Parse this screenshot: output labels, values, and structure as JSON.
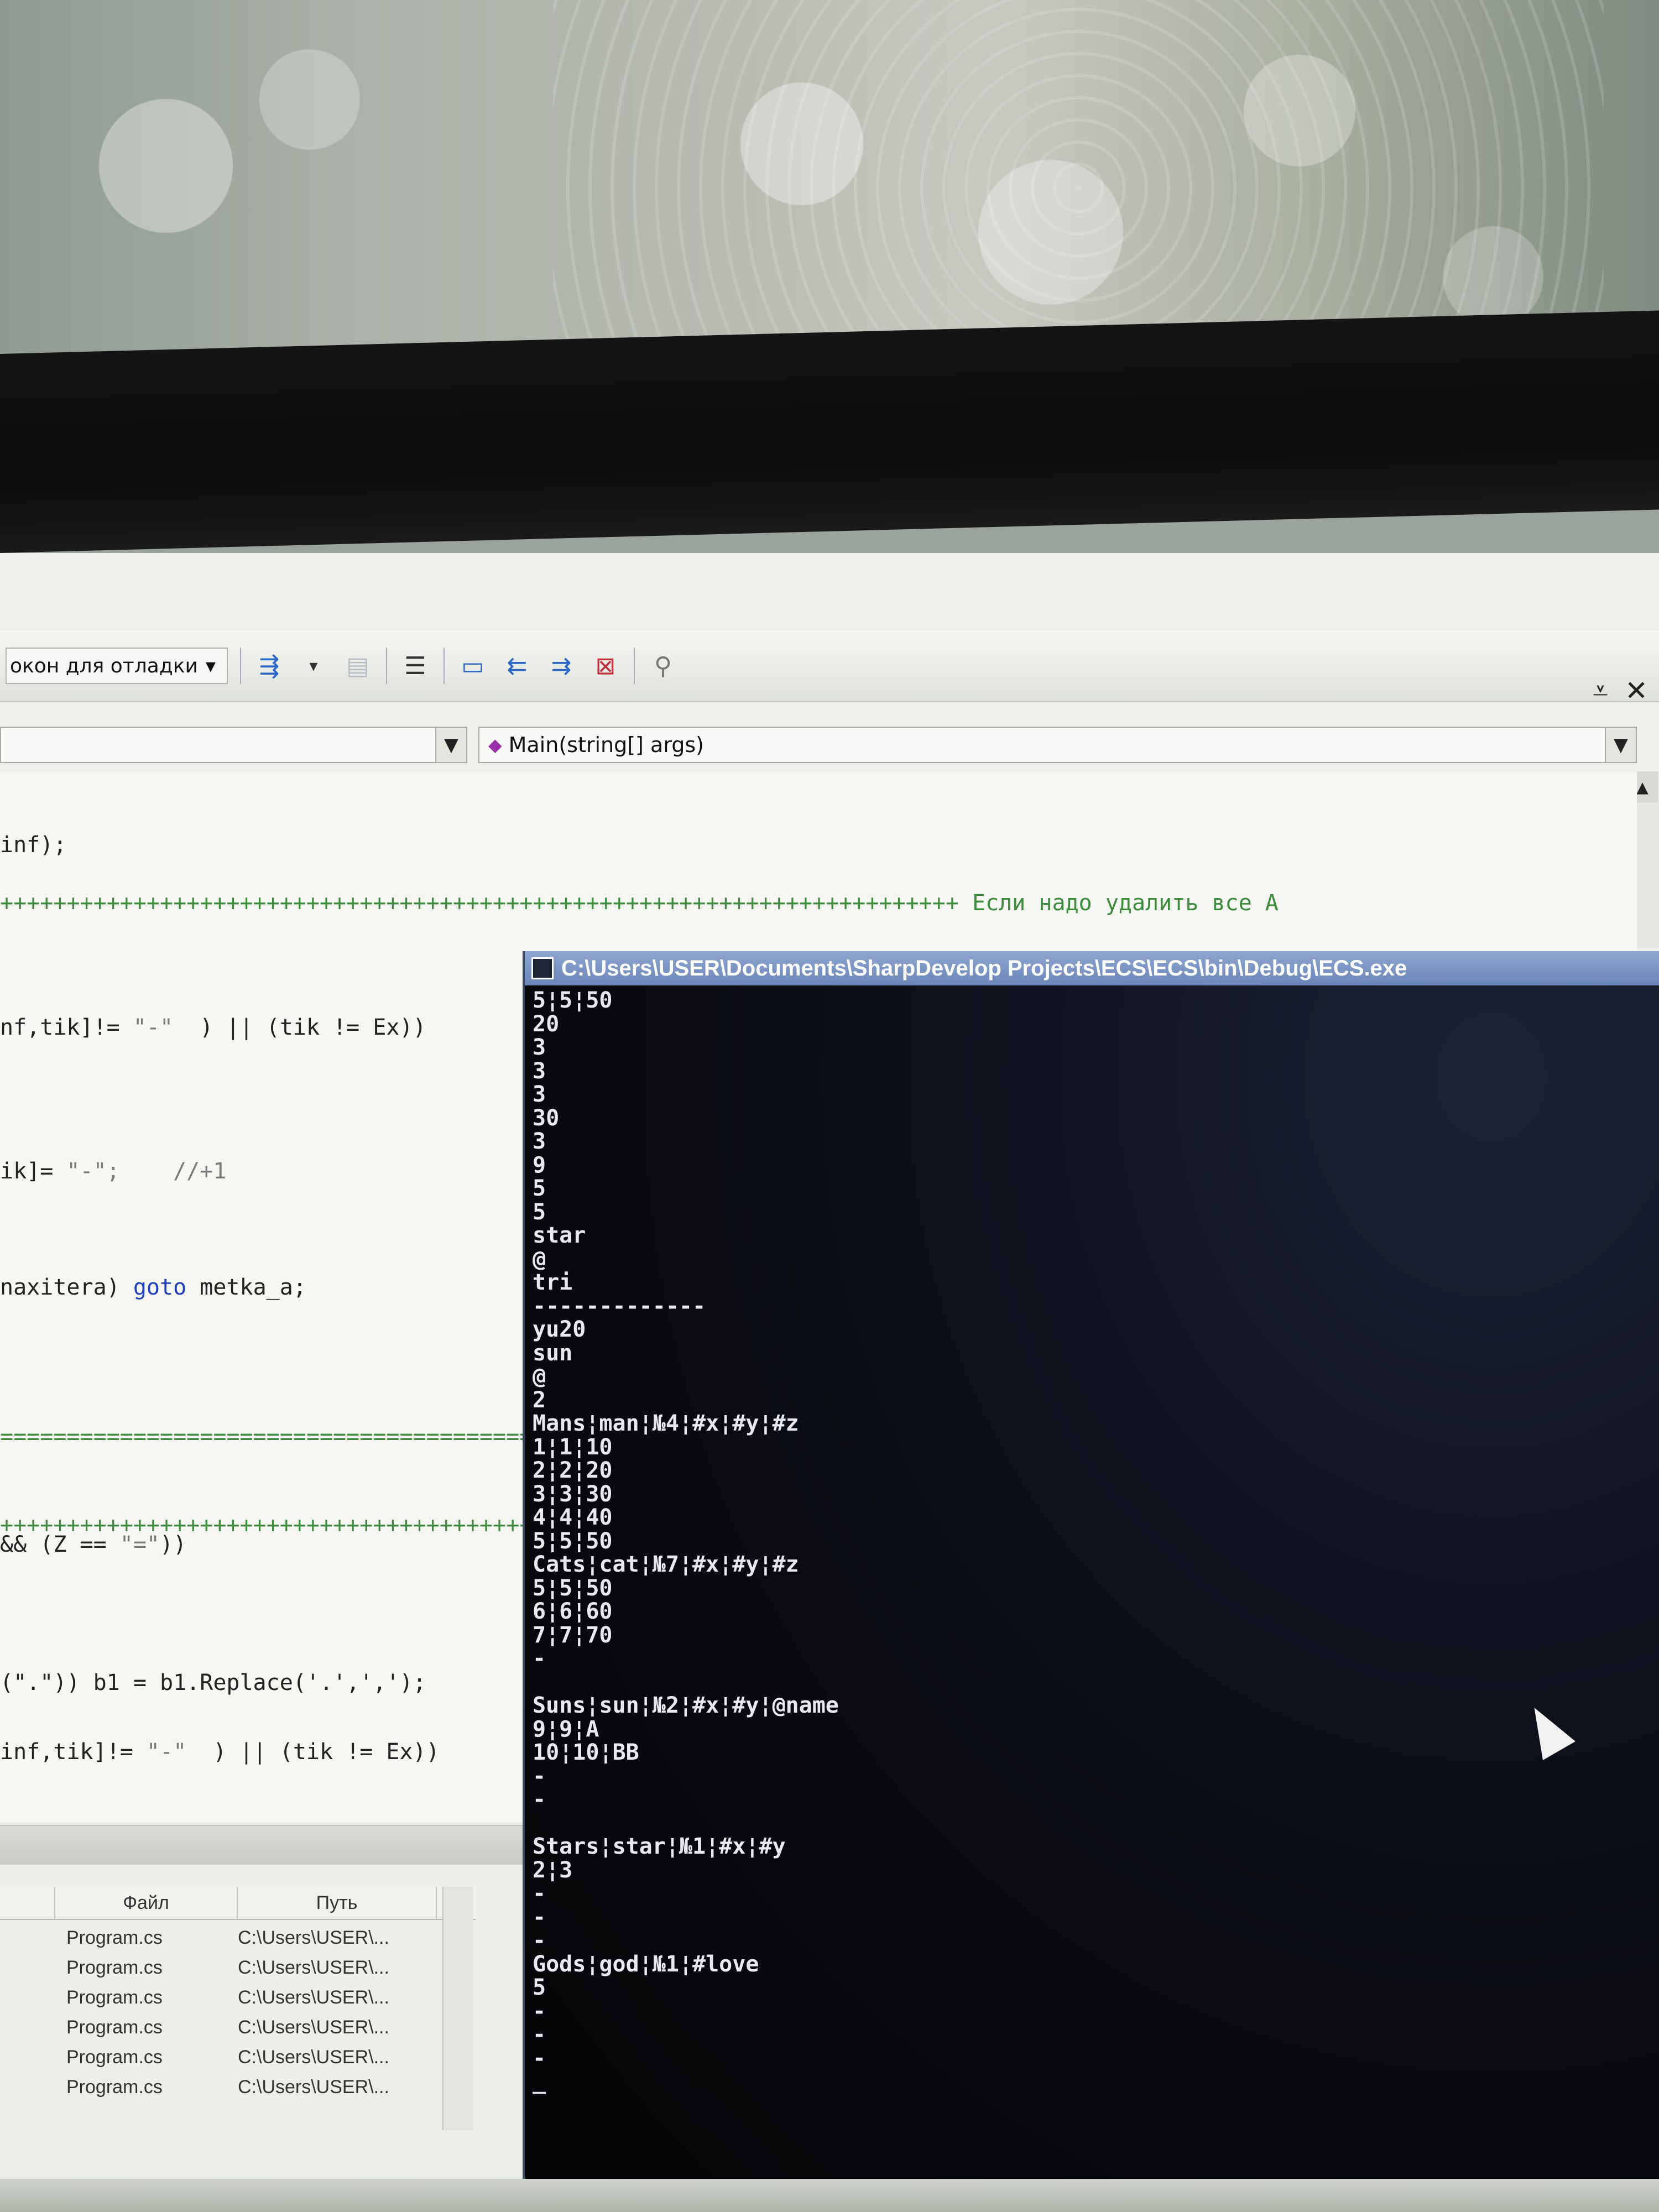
{
  "toolbar": {
    "layout_combo": "окон для отладки"
  },
  "navbar": {
    "method": "Main(string[] args)"
  },
  "code": {
    "line1": "inf);",
    "sep_plus": "++++++++++++++++++++++++++++++++++++++++++++++++++++++++++++++++++++++++ ",
    "comment": "Если надо удалить все А",
    "line3a": "nf,tik]!= ",
    "line3s": "\"-\"",
    "line3b": "  ) || (tik != Ex))",
    "line4a": "ik]= ",
    "line4s": "\"-\";",
    "line4c": "    //+1",
    "line5a": "naxitera) ",
    "line5kw": "goto",
    "line5b": " metka_a;",
    "sep_eq": "==========================================================",
    "sep_plus2": "+++++++++++++++++++++++++++++++++++++++++++++++++++++++++",
    "line7a": "&& (Z == ",
    "line7s": "\"=\"",
    "line7b": "))",
    "line8": "(\".\")) b1 = b1.Replace('.',',');",
    "line9a": "inf,tik]!= ",
    "line9s": "\"-\"",
    "line9b": "  ) || (tik != Ex))"
  },
  "panel": {
    "col_file": "Файл",
    "col_path": "Путь",
    "rows": [
      {
        "file": "Program.cs",
        "path": "C:\\Users\\USER\\..."
      },
      {
        "file": "Program.cs",
        "path": "C:\\Users\\USER\\..."
      },
      {
        "file": "Program.cs",
        "path": "C:\\Users\\USER\\..."
      },
      {
        "file": "Program.cs",
        "path": "C:\\Users\\USER\\..."
      },
      {
        "file": "Program.cs",
        "path": "C:\\Users\\USER\\..."
      },
      {
        "file": "Program.cs",
        "path": "C:\\Users\\USER\\..."
      }
    ]
  },
  "console": {
    "title": "C:\\Users\\USER\\Documents\\SharpDevelop Projects\\ECS\\ECS\\bin\\Debug\\ECS.exe",
    "output": "5¦5¦50\n20\n3\n3\n3\n30\n3\n9\n5\n5\nstar\n@\ntri\n-------------\nyu20\nsun\n@\n2\nMans¦man¦№4¦#x¦#y¦#z\n1¦1¦10\n2¦2¦20\n3¦3¦30\n4¦4¦40\n5¦5¦50\nCats¦cat¦№7¦#x¦#y¦#z\n5¦5¦50\n6¦6¦60\n7¦7¦70\n-\n\nSuns¦sun¦№2¦#x¦#y¦@name\n9¦9¦A\n10¦10¦BB\n-\n-\n\nStars¦star¦№1¦#x¦#y\n2¦3\n-\n-\n-\nGods¦god¦№1¦#love\n5\n-\n-\n-\n_"
  }
}
